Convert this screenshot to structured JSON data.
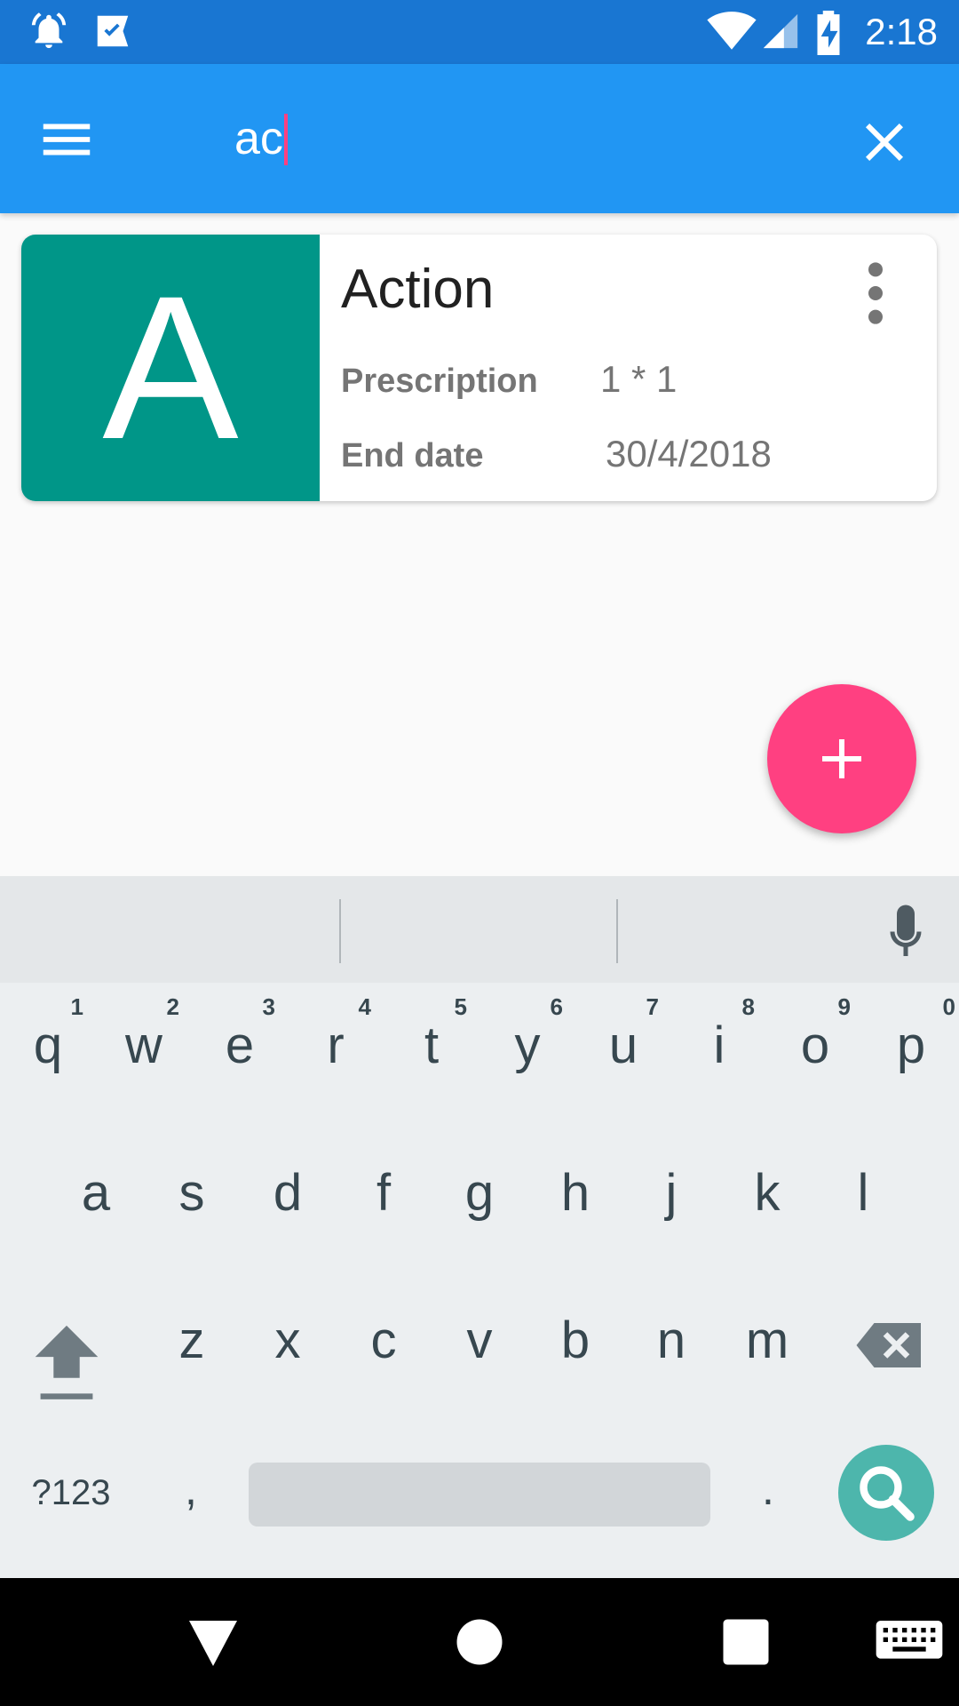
{
  "status_bar": {
    "time": "2:18",
    "icons": [
      "alarm-icon",
      "check-app-icon",
      "wifi-icon",
      "cell-signal-icon",
      "battery-charging-icon"
    ]
  },
  "app_bar": {
    "menu_icon": "menu-icon",
    "search": {
      "value": "ac",
      "placeholder": ""
    },
    "clear_icon": "close-icon"
  },
  "results": [
    {
      "avatar_letter": "A",
      "avatar_color": "#009688",
      "title": "Action",
      "rows": [
        {
          "label": "Prescription",
          "value": "1 * 1"
        },
        {
          "label": "End date",
          "value": "30/4/2018"
        }
      ],
      "more_icon": "more-vert-icon"
    }
  ],
  "fab": {
    "icon": "plus-icon",
    "color": "#ff4081"
  },
  "keyboard": {
    "row1": [
      {
        "key": "q",
        "hint": "1"
      },
      {
        "key": "w",
        "hint": "2"
      },
      {
        "key": "e",
        "hint": "3"
      },
      {
        "key": "r",
        "hint": "4"
      },
      {
        "key": "t",
        "hint": "5"
      },
      {
        "key": "y",
        "hint": "6"
      },
      {
        "key": "u",
        "hint": "7"
      },
      {
        "key": "i",
        "hint": "8"
      },
      {
        "key": "o",
        "hint": "9"
      },
      {
        "key": "p",
        "hint": "0"
      }
    ],
    "row2": [
      "a",
      "s",
      "d",
      "f",
      "g",
      "h",
      "j",
      "k",
      "l"
    ],
    "row3": [
      "z",
      "x",
      "c",
      "v",
      "b",
      "n",
      "m"
    ],
    "symbols_label": "?123",
    "comma": ",",
    "period": ".",
    "shift_icon": "shift-icon",
    "backspace_icon": "backspace-icon",
    "search_icon": "search-icon",
    "mic_icon": "mic-icon"
  },
  "nav_bar": {
    "icons": [
      "back-icon",
      "home-icon",
      "recents-icon",
      "keyboard-icon"
    ]
  },
  "colors": {
    "status_bar": "#1976d2",
    "app_bar": "#2196f3",
    "accent": "#ff4081",
    "avatar": "#009688",
    "keyboard_action": "#4db6ac"
  }
}
